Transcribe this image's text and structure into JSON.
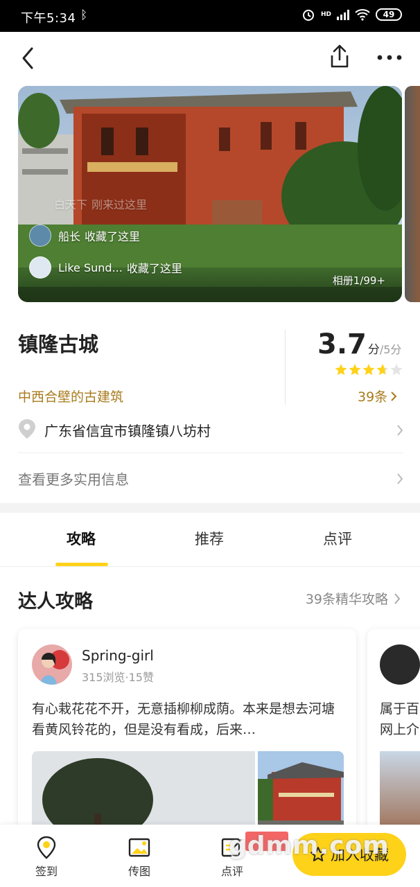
{
  "status_bar": {
    "time": "下午5:34",
    "network": "HD",
    "battery": "49"
  },
  "hero": {
    "feed": [
      {
        "name": "白天下",
        "action": "刚来过这里"
      },
      {
        "name": "船长",
        "action": "收藏了这里"
      },
      {
        "name": "Like Sund...",
        "action": "收藏了这里"
      }
    ],
    "album": "相册1/99+"
  },
  "info": {
    "title": "镇隆古城",
    "subtitle": "中西合壁的古建筑",
    "score": "3.7",
    "score_unit": "分",
    "score_total": "/5分",
    "rating": 3.7,
    "review_count": "39条",
    "address": "广东省信宜市镇隆镇八坊村",
    "more_info": "查看更多实用信息"
  },
  "tabs": [
    "攻略",
    "推荐",
    "点评"
  ],
  "guide_section": {
    "title": "达人攻略",
    "more": "39条精华攻略",
    "cards": [
      {
        "author": "Spring-girl",
        "stats": "315浏览·15赞",
        "excerpt": "有心栽花花不开，无意插柳柳成荫。本来是想去河塘看黄风铃花的，但是没有看成，后来…"
      },
      {
        "author": "",
        "stats": "",
        "excerpt": "属于百网上介"
      }
    ]
  },
  "bottom_bar": {
    "checkin": "签到",
    "upload": "传图",
    "review": "点评",
    "favorite": "加入收藏"
  },
  "watermark": "gdmm.com",
  "colors": {
    "accent": "#ffd21a",
    "gold_text": "#a87a1c"
  }
}
